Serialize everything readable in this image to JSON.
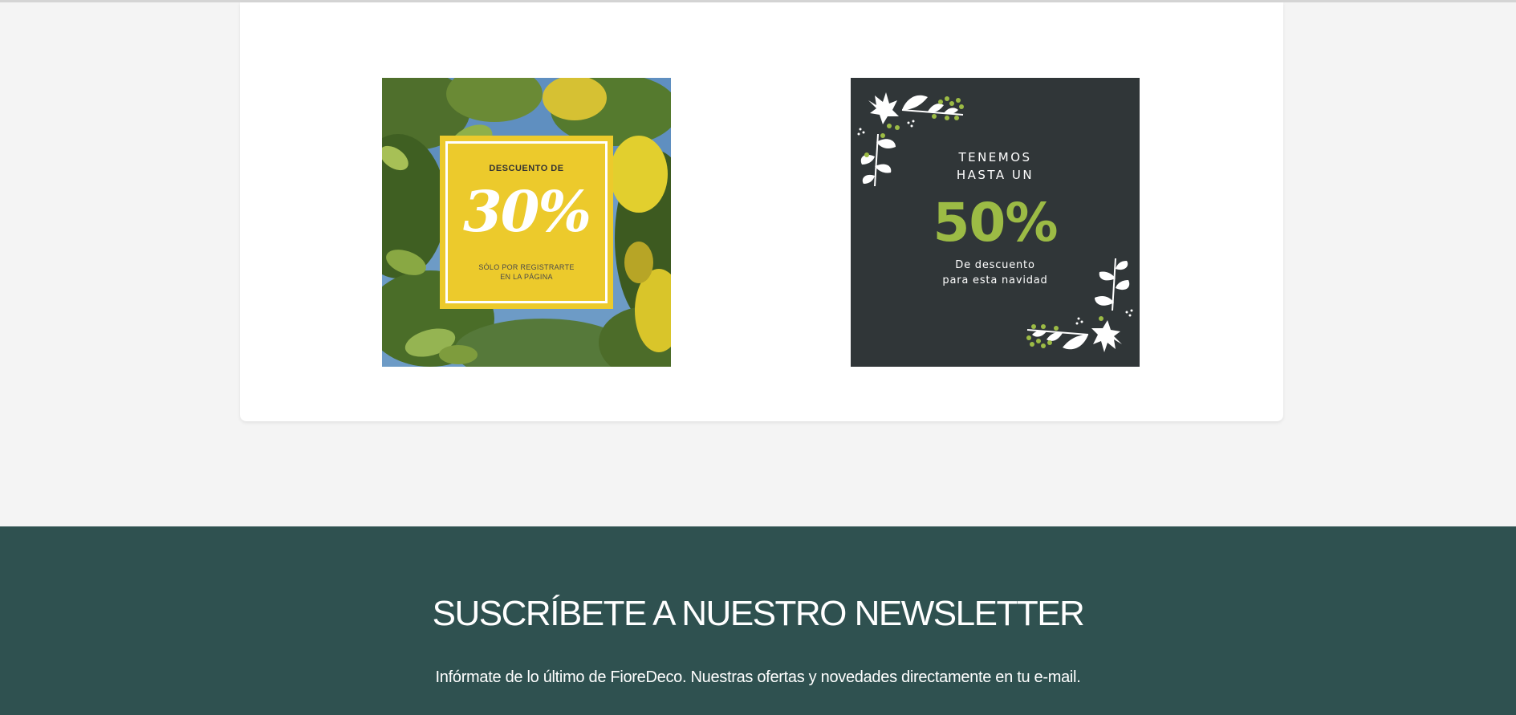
{
  "promo_lemon": {
    "heading": "DESCUENTO DE",
    "value": "30%",
    "sub_line1": "SÓLO POR REGISTRARTE",
    "sub_line2": "EN LA PÁGINA"
  },
  "promo_christmas": {
    "heading_line1": "TENEMOS",
    "heading_line2": "HASTA UN",
    "value": "50%",
    "sub_line1": "De descuento",
    "sub_line2": "para esta navidad"
  },
  "newsletter": {
    "title": "SUSCRÍBETE A NUESTRO NEWSLETTER",
    "description": "Infórmate de lo último de FioreDeco. Nuestras ofertas y novedades directamente en tu e-mail."
  },
  "colors": {
    "page_background": "#f4f4f4",
    "card_background": "#ffffff",
    "promo_yellow": "#ecca2c",
    "promo_dark": "#303638",
    "promo_green": "#9cbb45",
    "newsletter_background": "#2f5150"
  }
}
